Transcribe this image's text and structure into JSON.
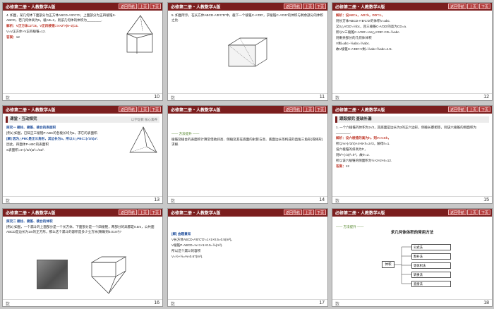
{
  "common": {
    "book": "必修第二册・人教数学A版",
    "nav_back": "返回导航",
    "nav_prev": "上页",
    "nav_next": "下页",
    "bottom_mark": "数"
  },
  "slides": [
    {
      "num": "10",
      "lines": [
        "4. 如图，某几何体下面部分为正方体ABCD-A′B′C′D′，上面部分为正四棱锥S-ABCD，若几何体高为5，棱AB=2，则该几何体的体积为________.",
        "解析：V正方体=2³=8，V正四棱锥=⅓×2²×(5−2)=4.",
        "V=V正方体+V正四棱锥=12."
      ],
      "answer_label": "答案：",
      "answer": "12"
    },
    {
      "num": "11",
      "lines": [
        "5. 如图所示，在长方体ABCD-A′B′C′D′中，截下一个棱锥C-A′DD′，求棱锥C-A′DD′的体积与剩余部分的体积之比."
      ]
    },
    {
      "num": "12",
      "lines": [
        "解析：设AB=a，AD=b，DD′=c，",
        "则长方体ABCD-A′B′C′D′的体积V=abc.",
        "又S△A′DD′=½bc，且三棱锥C-A′DD′的高为CD=a.",
        "所以V三棱锥C-A′DD′=⅓S△A′DD′·CD=⅙abc.",
        "则剩余部分的几何体体积",
        "V剩=abc−⅙abc=⅚abc.",
        "故V棱锥C-A′DD′∶V剩=⅙abc∶⅚abc=1∶5."
      ]
    },
    {
      "num": "13",
      "section": "课堂・互动探究",
      "section_side": "以学促教  核心素养",
      "lines": [
        "探究一  棱柱、棱锥、棱台的表面积",
        "[例1] 如图，已知正三棱锥P-ABC的各棱长均为a，求它的表面积.",
        "[解] 因为△PBC是正三角形，其边长为a，所以S△PBC=(√3/4)a².",
        "因此，四面体P-ABC的表面积",
        "S表面积=4×(√3/4)a²=√3a²."
      ]
    },
    {
      "num": "14",
      "heading": "—— 方法提升 ——",
      "lines": [
        "棱锥及棱台的表面积计算常借助斜高、侧棱及其在底面的射影与高、底面边长等构成的直角三角形(或梯形)求解."
      ]
    },
    {
      "num": "15",
      "section": "跟踪探究  查缺补漏",
      "lines": [
        "1. 一个六棱锥的体积为2√3，其底面是边长为2的正六边形，侧棱长都相等，则该六棱锥的侧面积为________.",
        "解析：设六棱锥的高为h，则V=⅓Sh，",
        "所以⅓×(√3/4)×4×6×h=2√3，解得h=1.",
        "设六棱锥的斜高为h′，",
        "则h²+(√3)²=h′²，故h′=2.",
        "所以该六棱锥的侧面积为½×2×2×6=12."
      ],
      "answer_label": "答案：",
      "answer": "12"
    },
    {
      "num": "16",
      "lines": [
        "探究二  棱柱、棱锥、棱台的体积",
        "[例2] 如图，一个漏斗的上面部分是一个长方体，下面部分是一个四棱锥，两部分的高都是0.5m，公共面ABCD是边长为1m的正方形，那么这个漏斗的容积是多少立方米(精确到0.01m³)?"
      ]
    },
    {
      "num": "17",
      "lines": [
        "[解] 由题意知",
        "V长方体ABCD-A′B′C′D′=1×1×0.5=0.5(m³)，",
        "V棱锥P-ABCD=⅓×1×1×0.5=⅙(m³).",
        "所以这个漏斗的容积",
        "V=½+⅙=⅔≈0.67(m³)."
      ]
    },
    {
      "num": "18",
      "heading": "—— 方法提升 ——",
      "diagram_title": "求几何体体积的常用方法",
      "diagram_center": "体积",
      "diagram_items": [
        "公式法",
        "割补法",
        "等体积法",
        "转换法",
        "直接法"
      ]
    }
  ]
}
